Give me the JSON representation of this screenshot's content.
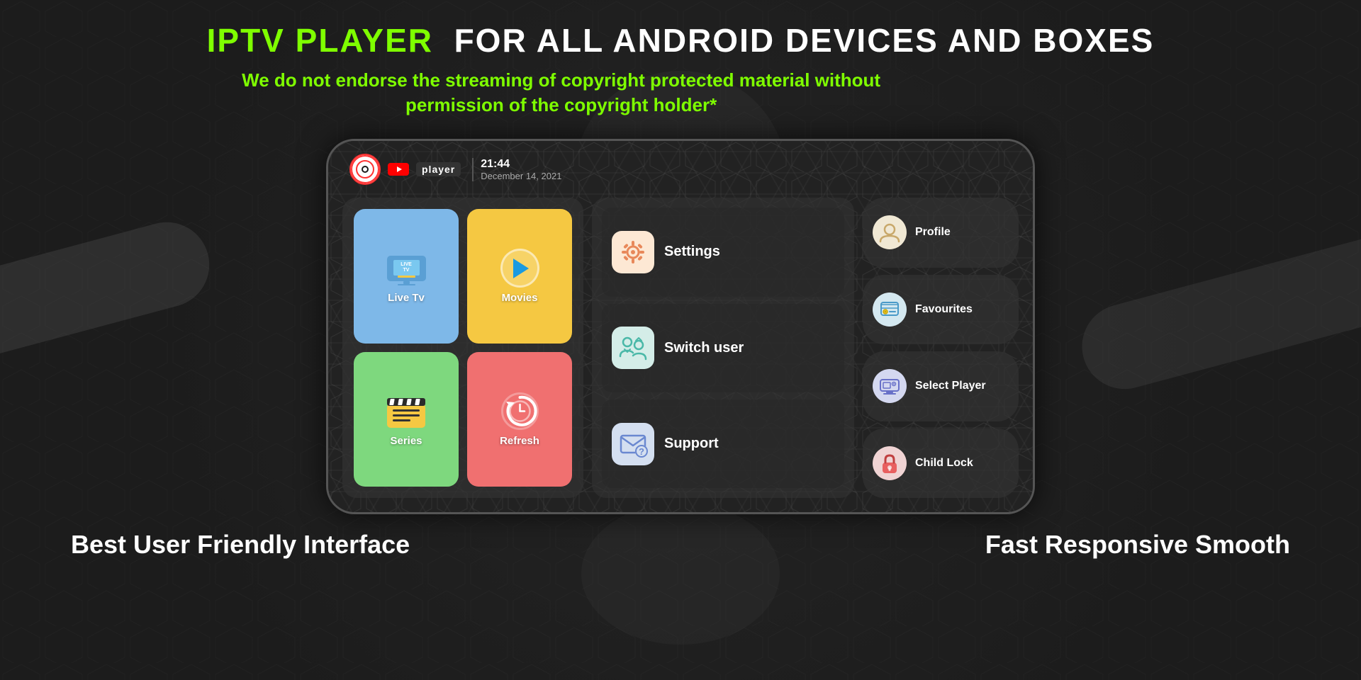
{
  "header": {
    "title_green": "IPTV PLAYER",
    "title_white": "FOR ALL ANDROID DEVICES AND BOXES",
    "subtitle": "We do not endorse the streaming of copyright protected material without permission of the copyright holder*"
  },
  "device": {
    "time": "21:44",
    "date": "December 14, 2021",
    "app_name": "player"
  },
  "menu_tiles": [
    {
      "id": "live-tv",
      "label": "Live Tv",
      "color": "#7eb8e8"
    },
    {
      "id": "movies",
      "label": "Movies",
      "color": "#f5c842"
    },
    {
      "id": "series",
      "label": "Series",
      "color": "#7ed87e"
    },
    {
      "id": "refresh",
      "label": "Refresh",
      "color": "#f07070"
    }
  ],
  "center_menu": [
    {
      "id": "settings",
      "label": "Settings"
    },
    {
      "id": "switch-user",
      "label": "Switch user"
    },
    {
      "id": "support",
      "label": "Support"
    }
  ],
  "side_menu": [
    {
      "id": "profile",
      "label": "Profile"
    },
    {
      "id": "favourites",
      "label": "Favourites"
    },
    {
      "id": "select-player",
      "label": "Select Player"
    },
    {
      "id": "child-lock",
      "label": "Child Lock"
    }
  ],
  "footer": {
    "left": "Best User Friendly Interface",
    "right": "Fast Responsive Smooth"
  }
}
